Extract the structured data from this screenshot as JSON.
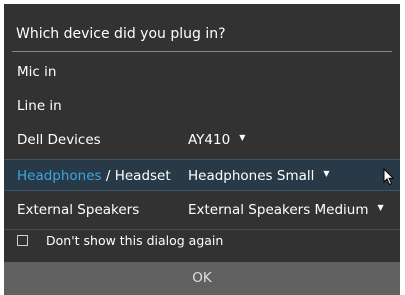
{
  "dialog": {
    "title": "Which device did you plug in?",
    "rows": [
      {
        "label": "Mic in",
        "value": ""
      },
      {
        "label": "Line in",
        "value": ""
      },
      {
        "label": "Dell Devices",
        "value": "AY410"
      },
      {
        "label_accent": "Headphones",
        "label_rest": " / Headset",
        "value": "Headphones Small",
        "selected": true
      },
      {
        "label": "External Speakers",
        "value": "External Speakers Medium"
      }
    ],
    "dropdown_caret": "▼",
    "checkbox_label": "Don't show this dialog again",
    "checkbox_checked": false,
    "ok_label": "OK"
  },
  "colors": {
    "background": "#323232",
    "accent": "#3fa3e6",
    "selected_row": "#283a47",
    "ok_button": "#616161"
  }
}
